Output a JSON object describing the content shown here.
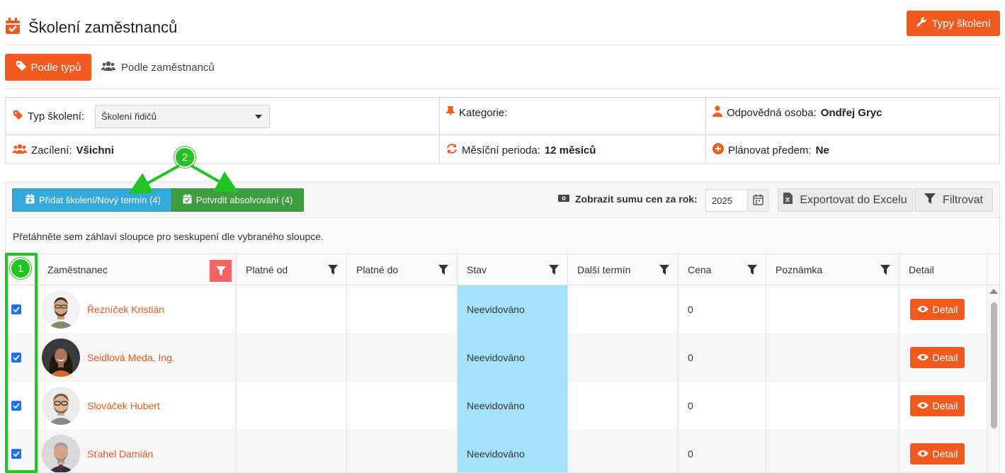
{
  "header": {
    "title": "Školení zaměstnanců",
    "types_button": "Typy školení"
  },
  "tabs": [
    {
      "label": "Podle typů",
      "active": true
    },
    {
      "label": "Podle zaměstnanců",
      "active": false
    }
  ],
  "info": {
    "type_label": "Typ školení:",
    "type_value": "Školení řidičů",
    "category_label": "Kategorie:",
    "responsible_label": "Odpovědná osoba:",
    "responsible_value": "Ondřej Gryc",
    "targeting_label": "Zacílení:",
    "targeting_value": "Všichni",
    "period_label": "Měsíční perioda:",
    "period_value": "12 měsíců",
    "plan_label": "Plánovat předem:",
    "plan_value": "Ne"
  },
  "toolbar": {
    "add_button": "Přidat školení/Nový termín (4)",
    "confirm_button": "Potvrdit absolvování (4)",
    "sum_label": "Zobrazit sumu cen za rok:",
    "year_value": "2025",
    "export_button": "Exportovat do Excelu",
    "filter_button": "Filtrovat"
  },
  "group_hint": "Přetáhněte sem záhlaví sloupce pro seskupení dle vybraného sloupce.",
  "columns": [
    "Zaměstnanec",
    "Platné od",
    "Platné do",
    "Stav",
    "Další termín",
    "Cena",
    "Poznámka",
    "Detail"
  ],
  "rows": [
    {
      "name": "Řezníček Kristián",
      "platne_od": "",
      "platne_do": "",
      "stav": "Neevidováno",
      "dalsi": "",
      "cena": "0",
      "poznamka": "",
      "detail": "Detail",
      "checked": true
    },
    {
      "name": "Seidlová Meda, Ing.",
      "platne_od": "",
      "platne_do": "",
      "stav": "Neevidováno",
      "dalsi": "",
      "cena": "0",
      "poznamka": "",
      "detail": "Detail",
      "checked": true
    },
    {
      "name": "Slováček Hubert",
      "platne_od": "",
      "platne_do": "",
      "stav": "Neevidováno",
      "dalsi": "",
      "cena": "0",
      "poznamka": "",
      "detail": "Detail",
      "checked": true
    },
    {
      "name": "Sťahel Damián",
      "platne_od": "",
      "platne_do": "",
      "stav": "Neevidováno",
      "dalsi": "",
      "cena": "0",
      "poznamka": "",
      "detail": "Detail",
      "checked": true
    }
  ],
  "annotations": {
    "badge1": "1",
    "badge2": "2"
  },
  "colors": {
    "accent": "#f05a1e",
    "add_button": "#35a9d9",
    "confirm_button": "#3e9d3e",
    "status_cell": "#a6e1fb",
    "annotation": "#22c322"
  }
}
